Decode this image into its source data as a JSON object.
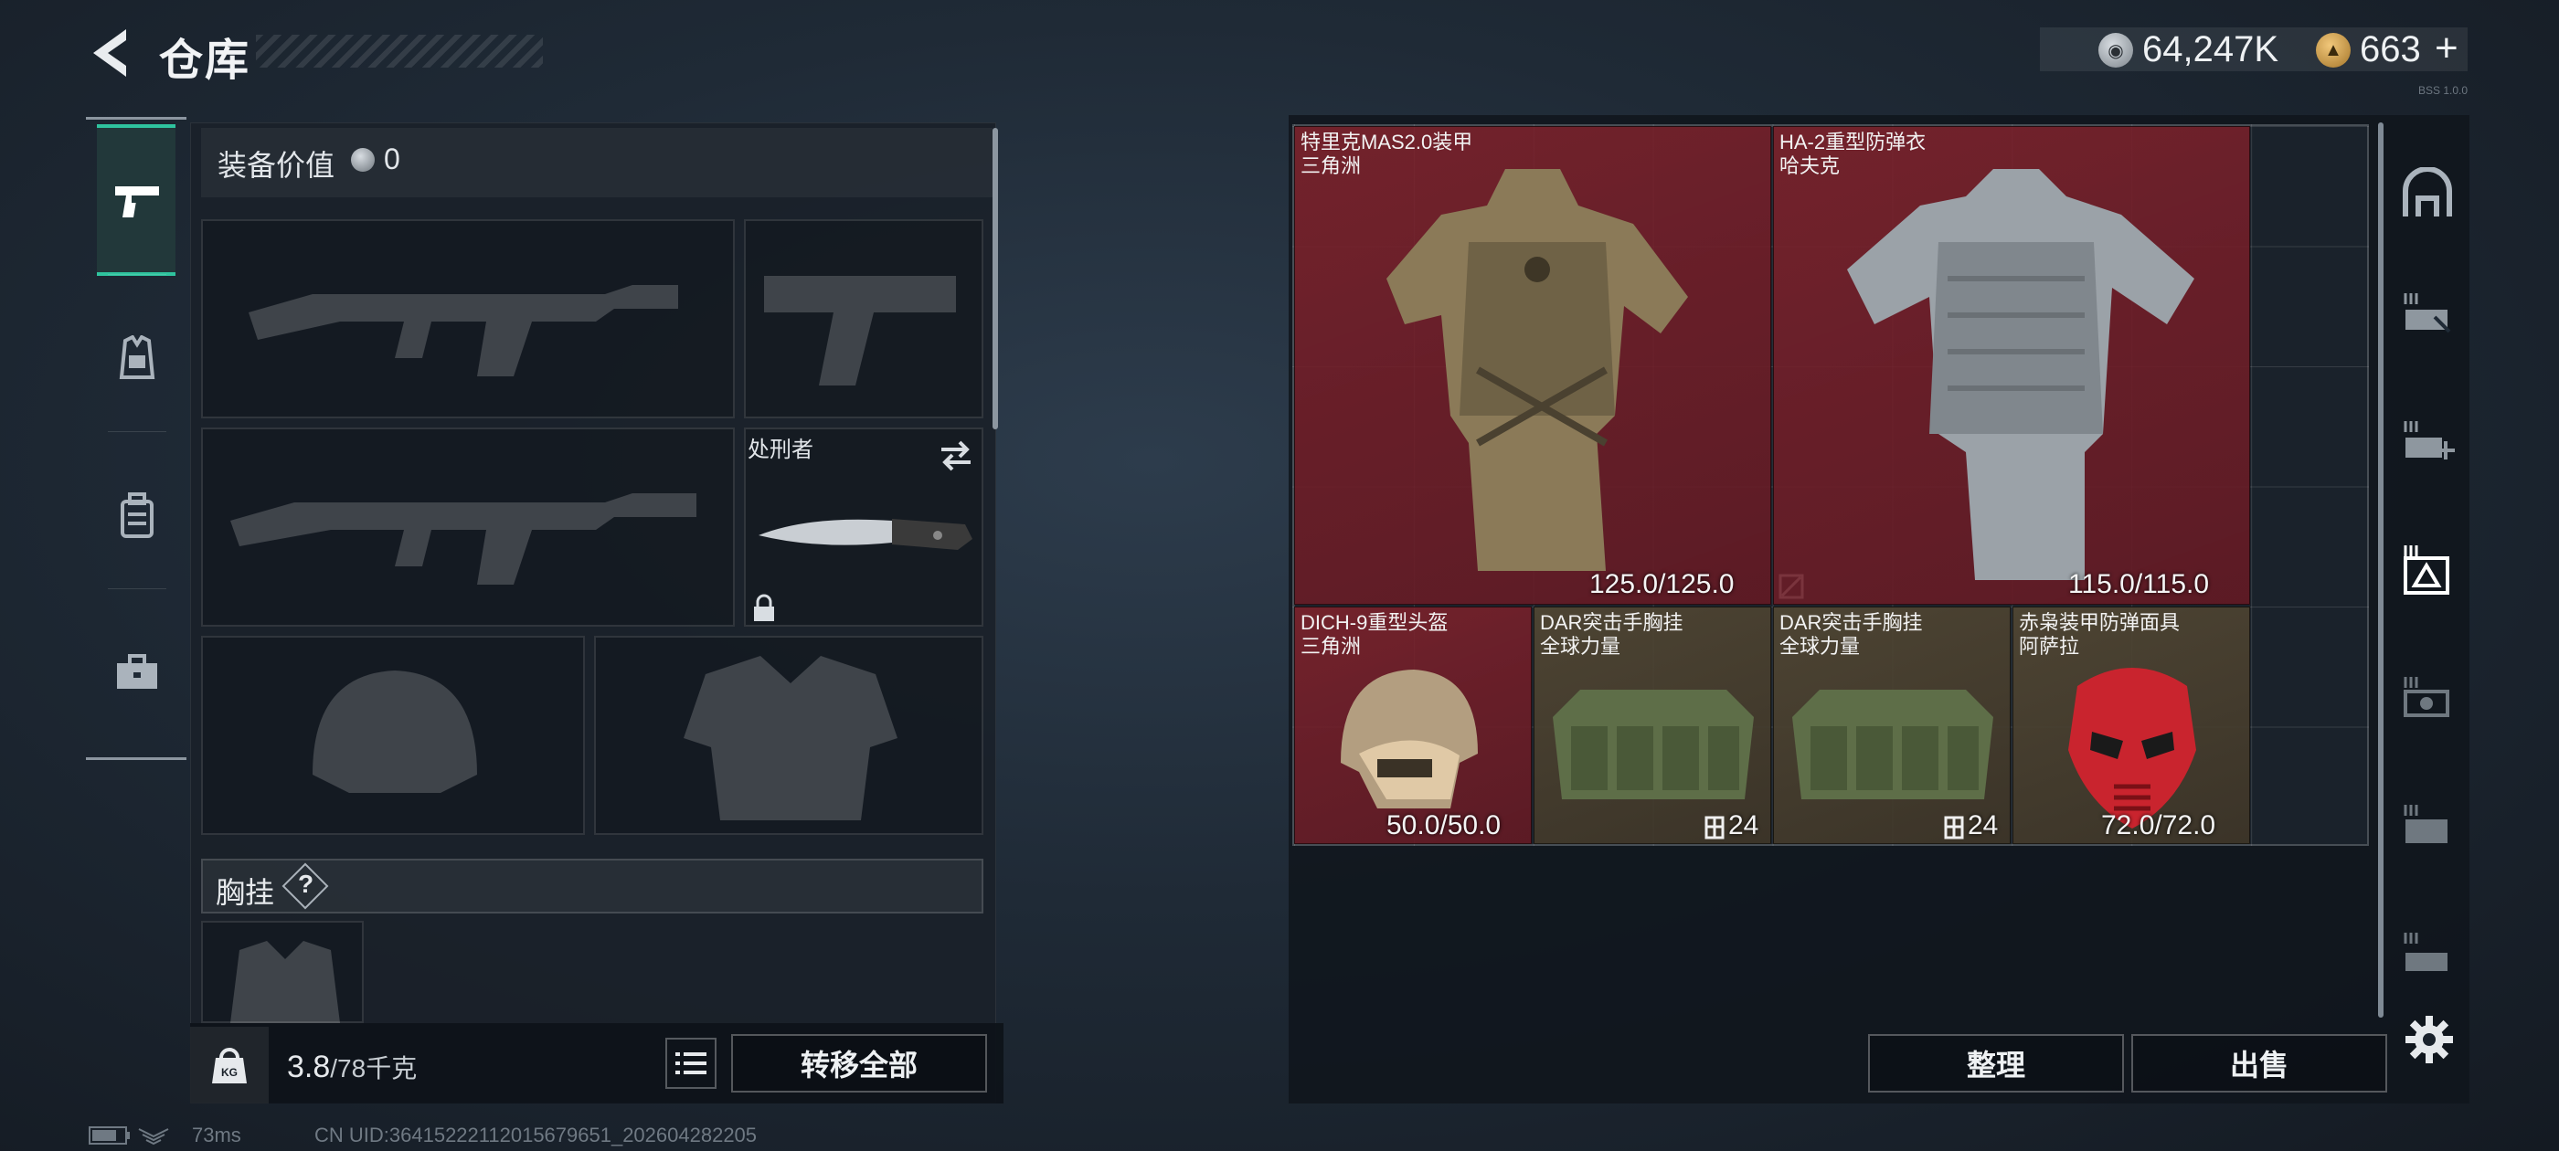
{
  "header": {
    "title": "仓库"
  },
  "currency": {
    "money": "64,247K",
    "coins": "663",
    "plus": "+"
  },
  "nav": {
    "categories": [
      "weapons",
      "armor",
      "backpack",
      "toolbox"
    ]
  },
  "equipment": {
    "value_label": "装备价值",
    "value": "0",
    "knife_name": "处刑者",
    "rig_label": "胸挂",
    "rig_help": "?"
  },
  "footer": {
    "weight": "3.8",
    "weight_max": "/78千克",
    "transfer_all": "转移全部"
  },
  "stash": {
    "items": [
      {
        "name": "特里克MAS2.0装甲",
        "sub": "三角洲",
        "durability": "125.0/125.0",
        "kind": "armor-camo"
      },
      {
        "name": "HA-2重型防弹衣",
        "sub": "哈夫克",
        "durability": "115.0/115.0",
        "kind": "armor-gray"
      },
      {
        "name": "DICH-9重型头盔",
        "sub": "三角洲",
        "durability": "50.0/50.0",
        "kind": "helmet"
      },
      {
        "name": "DAR突击手胸挂",
        "sub": "全球力量",
        "capacity": "24",
        "kind": "rig"
      },
      {
        "name": "DAR突击手胸挂",
        "sub": "全球力量",
        "capacity": "24",
        "kind": "rig"
      },
      {
        "name": "赤枭装甲防弹面具",
        "sub": "阿萨拉",
        "durability": "72.0/72.0",
        "kind": "mask"
      }
    ],
    "sort": "整理",
    "sell": "出售"
  },
  "status": {
    "ping": "73ms",
    "uid": "CN UID:3641522211201567965​1_202604282205",
    "version": "BSS 1.0.0"
  },
  "colors": {
    "accent": "#2fc39e",
    "item_red": "#8a2530",
    "item_olive": "#524834"
  }
}
